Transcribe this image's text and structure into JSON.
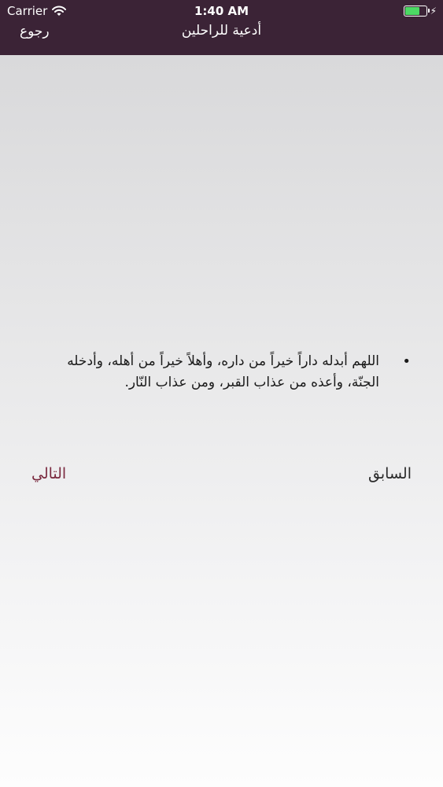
{
  "status_bar": {
    "carrier": "Carrier",
    "time": "1:40 AM",
    "battery_level": 0.7,
    "wifi_icon": "wifi-icon",
    "battery_icon": "battery-icon",
    "charging_icon": "bolt-icon"
  },
  "nav": {
    "back_label": "رجوع",
    "title": "أدعية للراحلين"
  },
  "content": {
    "dua_text": "اللهم أبدله داراً خيراً من داره، وأهلاً خيراً من أهله، وأدخله الجنّة، وأعذه من عذاب القبر، ومن عذاب النّار."
  },
  "footer": {
    "prev_label": "السابق",
    "next_label": "التالي"
  },
  "colors": {
    "nav_background": "#3b2336",
    "next_accent": "#7a2a3f",
    "battery_fill": "#4cd964"
  }
}
